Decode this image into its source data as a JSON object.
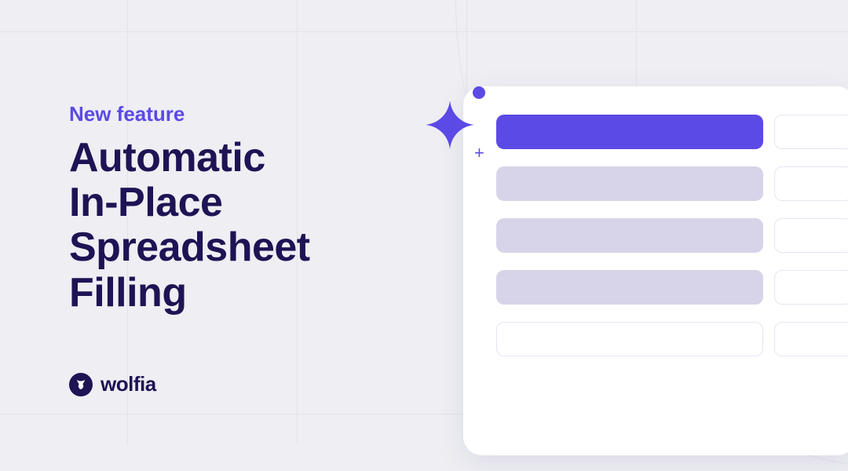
{
  "eyebrow": "New feature",
  "headline_line1": "Automatic",
  "headline_line2": "In-Place",
  "headline_line3": "Spreadsheet",
  "headline_line4": "Filling",
  "brand_name": "wolfia"
}
